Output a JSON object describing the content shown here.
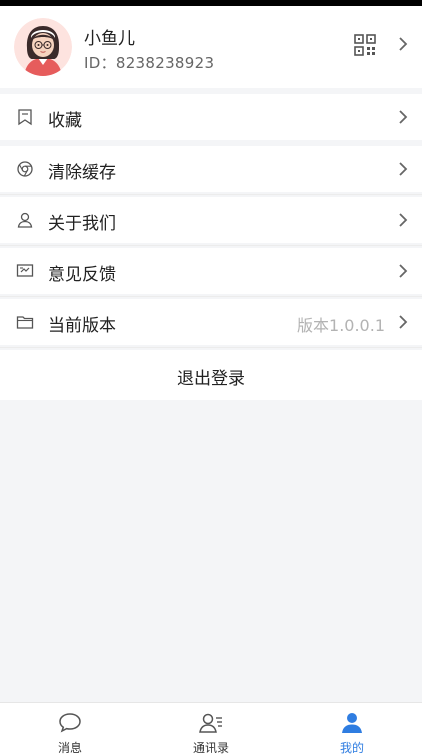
{
  "profile": {
    "name": "小鱼儿",
    "id": "ID：8238238923"
  },
  "menu": {
    "favorites": {
      "label": "收藏",
      "icon": "bookmark-icon"
    },
    "clear_cache": {
      "label": "清除缓存",
      "icon": "chrome-icon"
    },
    "about_us": {
      "label": "关于我们",
      "icon": "user-icon"
    },
    "feedback": {
      "label": "意见反馈",
      "icon": "feedback-icon"
    },
    "version": {
      "label": "当前版本",
      "value": "版本1.0.0.1",
      "icon": "folder-icon"
    }
  },
  "logout_label": "退出登录",
  "tabbar": {
    "tabs": [
      {
        "label": "消息",
        "icon": "chat-bubble-icon",
        "active": false
      },
      {
        "label": "通讯录",
        "icon": "contacts-icon",
        "active": false
      },
      {
        "label": "我的",
        "icon": "person-icon",
        "active": true
      }
    ]
  },
  "colors": {
    "accent": "#2f7de1",
    "background": "#f4f5f7",
    "secondary_text": "#b3b3b3"
  }
}
